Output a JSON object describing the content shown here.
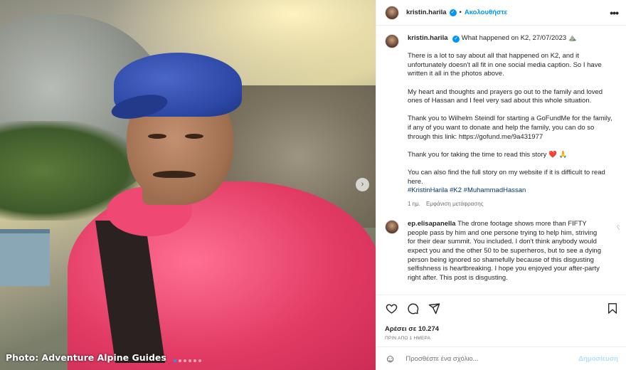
{
  "photo": {
    "credit": "Photo: Adventure Alpine Guides",
    "next_icon": "chevron-right-icon",
    "dots_total": 6,
    "dot_active_index": 0
  },
  "header": {
    "username": "kristin.harila",
    "separator": "•",
    "follow_label": "Ακολουθήστε",
    "more_icon": "more-horizontal-icon"
  },
  "caption": {
    "username": "kristin.harila",
    "title": "What happened on K2, 27/07/2023 ⛰️",
    "p1": "There is a lot to say about all that happened on K2, and it unfortunately doesn't all fit in one social media caption. So I have written it all in the photos above.",
    "p2": "My heart and thoughts and prayers go out to the family and loved ones of Hassan and I feel very sad about this whole situation.",
    "p3": "Thank you to Wilhelm Steindl for starting a GoFundMe for the family, if any of you want to donate and help the family, you can do so through this link: https://gofund.me/9a431977",
    "p4": "Thank you for taking the time to read this story ❤️ 🙏",
    "p5": "You can also find the full story on my website if it is difficult to read here.",
    "tags": "#KristinHarila #K2 #MuhammadHassan",
    "age": "1 ημ.",
    "translate": "Εμφάνιση μετάφρασης"
  },
  "comment": {
    "username": "ep.elisapanella",
    "text": "The drone footage shows more than FIFTY people pass by him and one persone trying to help him, striving for their dear summit. You included. I don't think anybody would expect you and the other 50 to be superheros, but to see a dying person being ignored so shamefully because of this disgusting selfishness is heartbreaking. I hope you enjoyed your after-party right after. This post is disgusting."
  },
  "actions": {
    "like_icon": "heart-icon",
    "comment_icon": "comment-icon",
    "share_icon": "paper-plane-icon",
    "save_icon": "bookmark-icon",
    "likes": "Αρέσει σε 10.274",
    "timestamp": "ΠΡΙΝ ΑΠΟ 1 ΗΜΕΡΑ"
  },
  "add_comment": {
    "emoji_icon": "smiley-icon",
    "placeholder": "Προσθέστε ένα σχόλιο...",
    "post_label": "Δημοσίευση"
  }
}
